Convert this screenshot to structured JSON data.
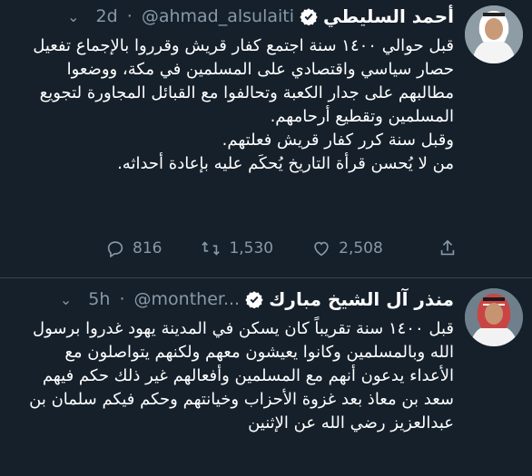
{
  "tweets": [
    {
      "name": "أحمد السليطي",
      "handle": "@ahmad_alsulaiti",
      "time": "2d",
      "text": "قبل حوالي ١٤٠٠ سنة اجتمع كفار قريش وقرروا بالإجماع تفعيل حصار سياسي واقتصادي على المسلمين في مكة، ووضعوا مطالبهم على جدار الكعبة وتحالفوا مع القبائل المجاورة لتجويع المسلمين وتقطيع أرحامهم.\nوقبل سنة كرر كفار قريش فعلتهم.\nمن لا يُحسن قرأة التاريخ يُحكَم عليه بإعادة أحداثه.",
      "replies": "816",
      "retweets": "1,530",
      "likes": "2,508"
    },
    {
      "name": "منذر آل الشيخ مبارك",
      "handle": "@monther...",
      "time": "5h",
      "text": "قبل ١٤٠٠ سنة تقريباً كان يسكن في المدينة يهود غدروا برسول الله وبالمسلمين وكانوا يعيشون معهم ولكنهم يتواصلون مع الأعداء يدعون أنهم مع المسلمين وأفعالهم غير ذلك حكم فيهم سعد بن معاذ بعد غزوة الأحزاب وخيانتهم وحكم فيكم سلمان بن عبدالعزيز رضي الله عن الإثنين"
    }
  ],
  "colors": {
    "background": "#15202b",
    "text": "#ffffff",
    "muted": "#8899a6",
    "verified": "#ffffff",
    "divider": "#38444d"
  },
  "icons": [
    "chevron-down-icon",
    "verified-icon",
    "reply-icon",
    "retweet-icon",
    "like-icon",
    "share-icon"
  ]
}
